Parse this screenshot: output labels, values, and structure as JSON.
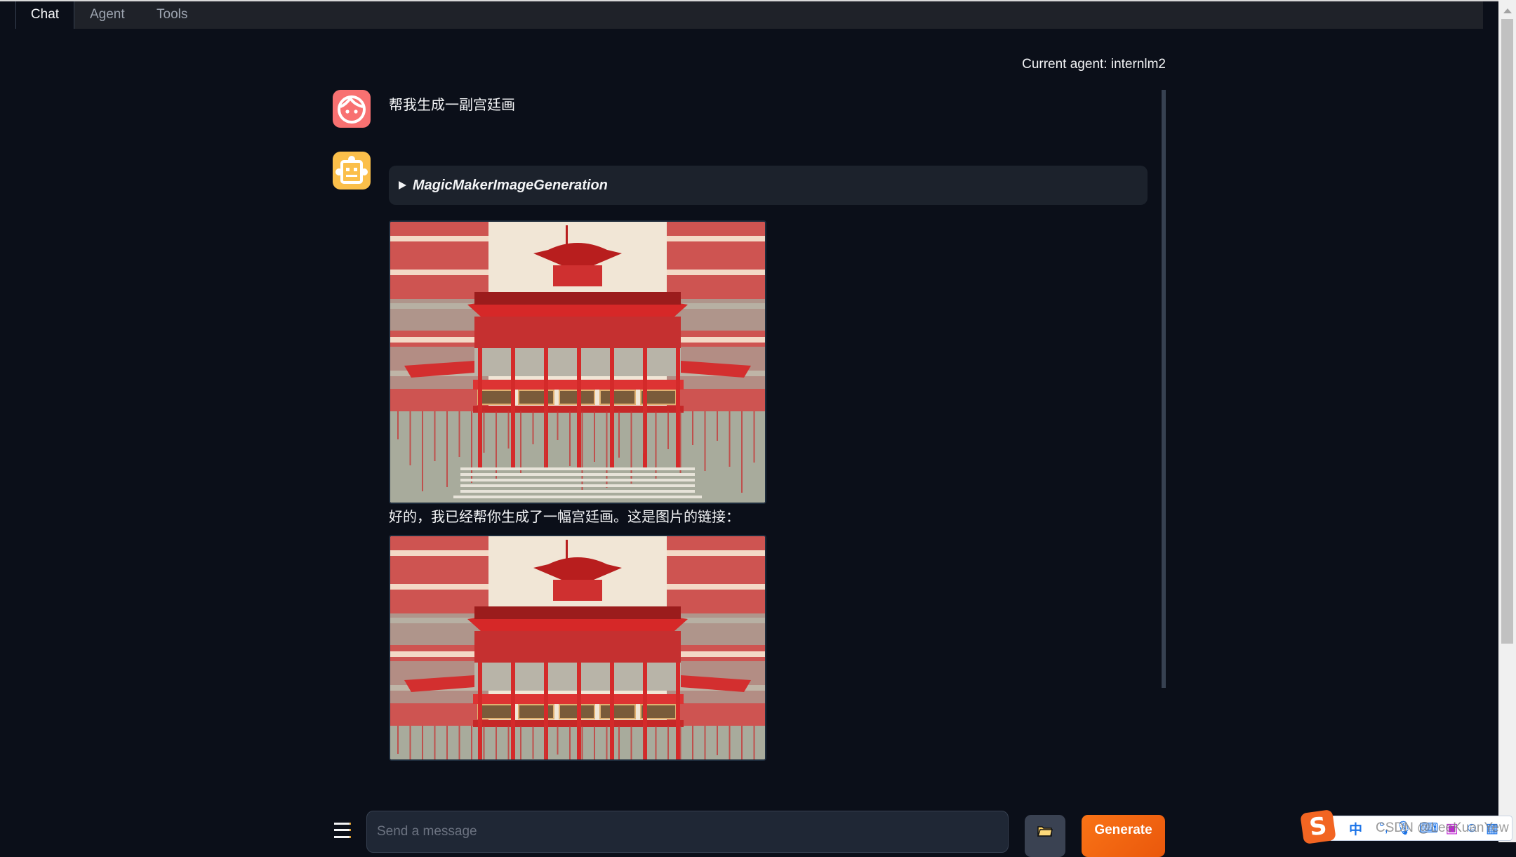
{
  "tabs": [
    {
      "label": "Chat",
      "active": true
    },
    {
      "label": "Agent",
      "active": false
    },
    {
      "label": "Tools",
      "active": false
    }
  ],
  "header": {
    "current_agent_label": "Current agent: internlm2"
  },
  "conversation": {
    "user_message": "帮我生成一副宫廷画",
    "tool_call": {
      "name": "MagicMakerImageGeneration",
      "expanded": false
    },
    "bot_message": "好的，我已经帮你生成了一幅宫廷画。这是图片的链接：",
    "image_description": "Red Chinese palace illustration"
  },
  "input": {
    "placeholder": "Send a message",
    "value": ""
  },
  "buttons": {
    "generate": "Generate",
    "folder_icon": "📁",
    "menu_icon": "hamburger"
  },
  "ime": {
    "logo": "S",
    "mode": "中",
    "watermark": "CSDN @LeeKuanYew"
  },
  "colors": {
    "accent": "#f97316",
    "background": "#0b0f19",
    "user_avatar": "#f87171",
    "bot_avatar": "#fbbf4a"
  }
}
